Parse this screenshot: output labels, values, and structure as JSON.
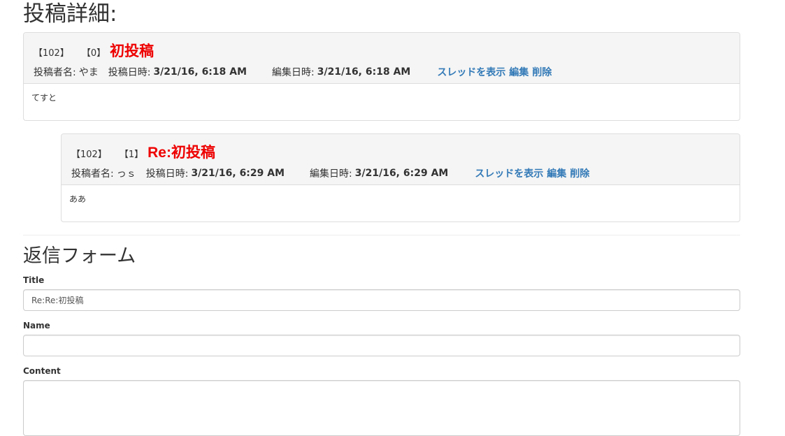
{
  "page": {
    "title": "投稿詳細:"
  },
  "posts": [
    {
      "number": "【102】",
      "reply_index": "【0】",
      "title": "初投稿",
      "author_label": "投稿者名:",
      "author": "やま",
      "posted_label": "投稿日時:",
      "posted_at": "3/21/16, 6:18 AM",
      "edited_label": "編集日時:",
      "edited_at": "3/21/16, 6:18 AM",
      "links": {
        "thread": "スレッドを表示",
        "edit": "編集",
        "delete": "削除"
      },
      "body": "てすと"
    },
    {
      "number": "【102】",
      "reply_index": "【1】",
      "title": "Re:初投稿",
      "author_label": "投稿者名:",
      "author": "っｓ",
      "posted_label": "投稿日時:",
      "posted_at": "3/21/16, 6:29 AM",
      "edited_label": "編集日時:",
      "edited_at": "3/21/16, 6:29 AM",
      "links": {
        "thread": "スレッドを表示",
        "edit": "編集",
        "delete": "削除"
      },
      "body": "ああ"
    }
  ],
  "reply_form": {
    "heading": "返信フォーム",
    "title_label": "Title",
    "title_value": "Re:Re:初投稿",
    "name_label": "Name",
    "name_value": "",
    "content_label": "Content",
    "content_value": ""
  }
}
